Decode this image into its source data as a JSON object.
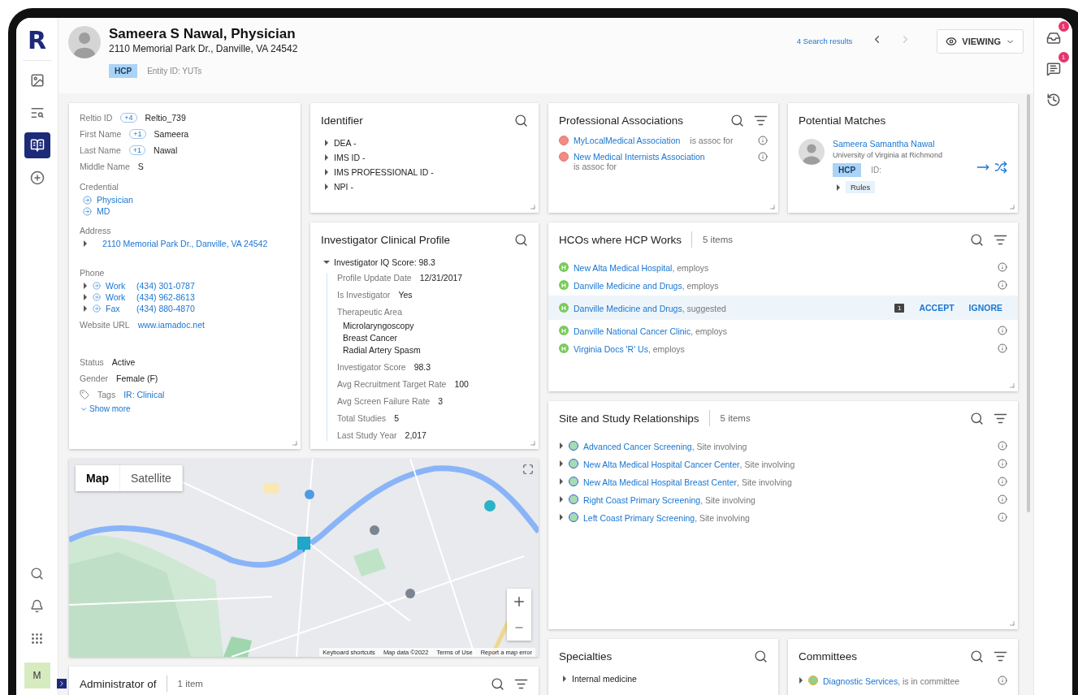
{
  "sidebar": {
    "logo": "R",
    "nav": [
      {
        "kind": "media",
        "selected": false
      },
      {
        "kind": "search-list",
        "selected": false
      },
      {
        "kind": "profile",
        "selected": true
      },
      {
        "kind": "add",
        "selected": false
      }
    ],
    "tools": [
      {
        "kind": "search"
      },
      {
        "kind": "bell"
      },
      {
        "kind": "apps"
      }
    ],
    "user": "M"
  },
  "header": {
    "name": "Sameera S Nawal, Physician",
    "address": "2110 Memorial Park Dr., Danville, VA 24542",
    "type": "HCP",
    "entity_id": "Entity ID: YUTs",
    "search_results": "4 Search results",
    "prev_disabled": false,
    "next_disabled": true,
    "mode": "VIEWING"
  },
  "attributes": {
    "rows": [
      {
        "kind": "field",
        "label": "Reltio ID",
        "badge": "+4",
        "value": "Reltio_739"
      },
      {
        "kind": "field",
        "label": "First Name",
        "badge": "+1",
        "value": "Sameera"
      },
      {
        "kind": "field",
        "label": "Last Name",
        "badge": "+1",
        "value": "Nawal"
      },
      {
        "kind": "field",
        "label": "Middle Name",
        "value": "S"
      },
      {
        "kind": "nested",
        "label": "Credential",
        "items": [
          {
            "value": "Physician"
          },
          {
            "value": "MD"
          }
        ]
      },
      {
        "kind": "address",
        "label": "Address",
        "items": [
          {
            "value": "2110 Memorial Park Dr., Danville, VA 24542",
            "expanded": false
          }
        ]
      },
      {
        "kind": "phone",
        "label": "Phone",
        "items": [
          {
            "type": "Work",
            "value": "(434) 301-0787",
            "expanded": false
          },
          {
            "type": "Work",
            "value": "(434) 962-8613",
            "expanded": false
          },
          {
            "type": "Fax",
            "value": "(434) 880-4870",
            "expanded": false
          }
        ]
      },
      {
        "kind": "link",
        "label": "Website URL",
        "value": "www.iamadoc.net"
      },
      {
        "kind": "field",
        "label": "Status",
        "value": "Active"
      },
      {
        "kind": "field",
        "label": "Gender",
        "value": "Female (F)"
      },
      {
        "kind": "tags",
        "label": "Tags",
        "value": "IR: Clinical"
      }
    ],
    "show_more": "Show more"
  },
  "identifier": {
    "title": "Identifier",
    "items": [
      {
        "label": "DEA -",
        "expanded": false
      },
      {
        "label": "IMS ID -",
        "expanded": false
      },
      {
        "label": "IMS PROFESSIONAL ID -",
        "expanded": false
      },
      {
        "label": "NPI -",
        "expanded": false
      }
    ]
  },
  "clinical_profile": {
    "title": "Investigator Clinical Profile",
    "root": {
      "label": "Investigator IQ Score: 98.3",
      "expanded": true,
      "children": [
        {
          "label": "Profile Update Date",
          "value": "12/31/2017"
        },
        {
          "label": "Is Investigator",
          "value": "Yes"
        },
        {
          "label": "Therapeutic Area",
          "values": [
            "Microlaryngoscopy",
            "Breast Cancer",
            "Radial Artery Spasm"
          ]
        },
        {
          "label": "Investigator Score",
          "value": "98.3"
        },
        {
          "label": "Avg Recruitment Target Rate",
          "value": "100"
        },
        {
          "label": "Avg Screen Failure Rate",
          "value": "3"
        },
        {
          "label": "Total Studies",
          "value": "5"
        },
        {
          "label": "Last Study Year",
          "value": "2,017"
        }
      ]
    }
  },
  "map": {
    "tabs": [
      {
        "label": "Map",
        "selected": true
      },
      {
        "label": "Satellite",
        "selected": false
      }
    ],
    "footer": [
      "Keyboard shortcuts",
      "Map data ©2022",
      "Terms of Use",
      "Report a map error"
    ]
  },
  "administrator_of": {
    "title": "Administrator of",
    "count": "1 item"
  },
  "professional_associations": {
    "title": "Professional Associations",
    "items": [
      {
        "name": "MyLocalMedical Association",
        "relation": "is assoc for"
      },
      {
        "name": "New Medical Internists Association",
        "relation": "is assoc for"
      }
    ]
  },
  "potential_matches": {
    "title": "Potential Matches",
    "match": {
      "name": "Sameera Samantha Nawal",
      "org": "University of Virginia at Richmond",
      "type": "HCP",
      "id": "ID:",
      "rules": "Rules",
      "rules_expanded": false
    }
  },
  "hcos": {
    "title": "HCOs where HCP Works",
    "count": "5 items",
    "items": [
      {
        "kind": "relation",
        "initial": "H",
        "name": "New Alta Medical Hospital",
        "relation": ", employs"
      },
      {
        "kind": "relation",
        "initial": "H",
        "name": "Danville Medicine and Drugs",
        "relation": ", employs"
      },
      {
        "kind": "suggestion",
        "initial": "H",
        "name": "Danville Medicine and Drugs",
        "relation": ", suggested",
        "comments": "1",
        "accept": "ACCEPT",
        "ignore": "IGNORE"
      },
      {
        "kind": "relation",
        "initial": "H",
        "name": "Danville National Cancer Clinic",
        "relation": ", employs"
      },
      {
        "kind": "relation",
        "initial": "H",
        "name": "Virginia Docs 'R' Us",
        "relation": ", employs"
      }
    ]
  },
  "site_relationships": {
    "title": "Site and Study Relationships",
    "count": "5 items",
    "items": [
      {
        "name": "Advanced Cancer Screening",
        "relation": ", Site involving",
        "expanded": false
      },
      {
        "name": "New Alta Medical Hospital Cancer Center",
        "relation": ", Site involving",
        "expanded": false
      },
      {
        "name": "New Alta Medical Hospital Breast Center",
        "relation": ", Site involving",
        "expanded": false
      },
      {
        "name": "Right Coast Primary Screening",
        "relation": ", Site involving",
        "expanded": false
      },
      {
        "name": "Left Coast Primary Screening",
        "relation": ", Site involving",
        "expanded": false
      }
    ]
  },
  "specialties": {
    "title": "Specialties",
    "items": [
      {
        "label": "Internal medicine",
        "expanded": false
      }
    ]
  },
  "committees": {
    "title": "Committees",
    "items": [
      {
        "name": "Diagnostic Services",
        "relation": ", is in committee",
        "expanded": false
      }
    ]
  },
  "right_rail": [
    {
      "kind": "inbox",
      "badge": "1"
    },
    {
      "kind": "chat",
      "badge": "1"
    },
    {
      "kind": "history"
    }
  ]
}
